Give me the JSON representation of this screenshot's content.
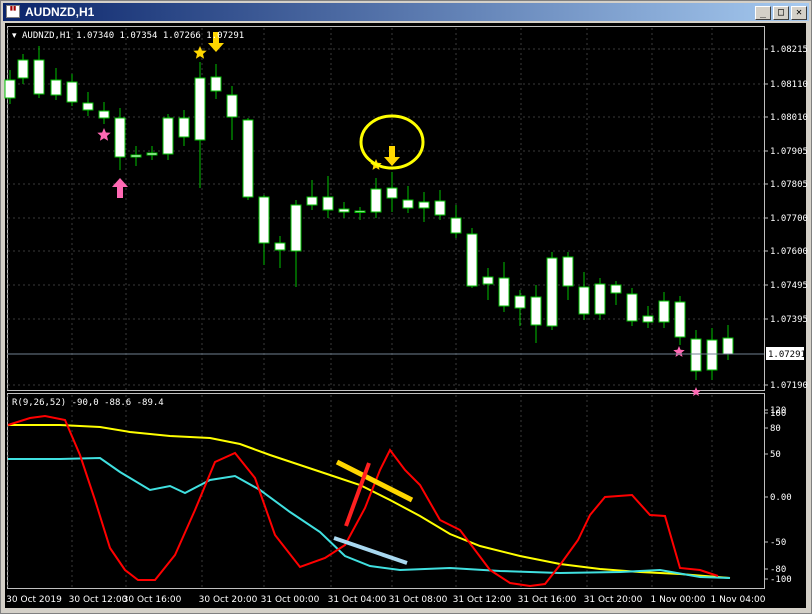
{
  "window": {
    "title": "AUDNZD,H1",
    "controls": {
      "minimize": "_",
      "maximize": "□",
      "close": "✕"
    }
  },
  "chart": {
    "header": "AUDNZD,H1  1.07340 1.07354 1.07266 1.07291",
    "price_labels": [
      "1.08215",
      "1.08110",
      "1.08010",
      "1.07905",
      "1.07805",
      "1.07700",
      "1.07600",
      "1.07495",
      "1.07395",
      "1.07190"
    ],
    "current_price": "1.07291",
    "time_labels": [
      "30 Oct 2019",
      "30 Oct 12:00",
      "30 Oct 16:00",
      "30 Oct 20:00",
      "31 Oct 00:00",
      "31 Oct 04:00",
      "31 Oct 08:00",
      "31 Oct 12:00",
      "31 Oct 16:00",
      "31 Oct 20:00",
      "1 Nov 00:00",
      "1 Nov 04:00"
    ]
  },
  "indicator": {
    "header": "R(9,26,52) -90,0 -88.6 -89.4",
    "levels": [
      "120",
      "100",
      "80",
      "50",
      "0.00",
      "-50",
      "-80",
      "-100"
    ]
  },
  "colors": {
    "bull_candle": "#000000",
    "bear_candle": "#ffffff",
    "wick": "#00c000",
    "line_red": "#ff0000",
    "line_yellow": "#ffff00",
    "line_cyan": "#40e0e0",
    "marker_pink": "#ff69b4",
    "marker_yellow": "#ffd700"
  }
}
